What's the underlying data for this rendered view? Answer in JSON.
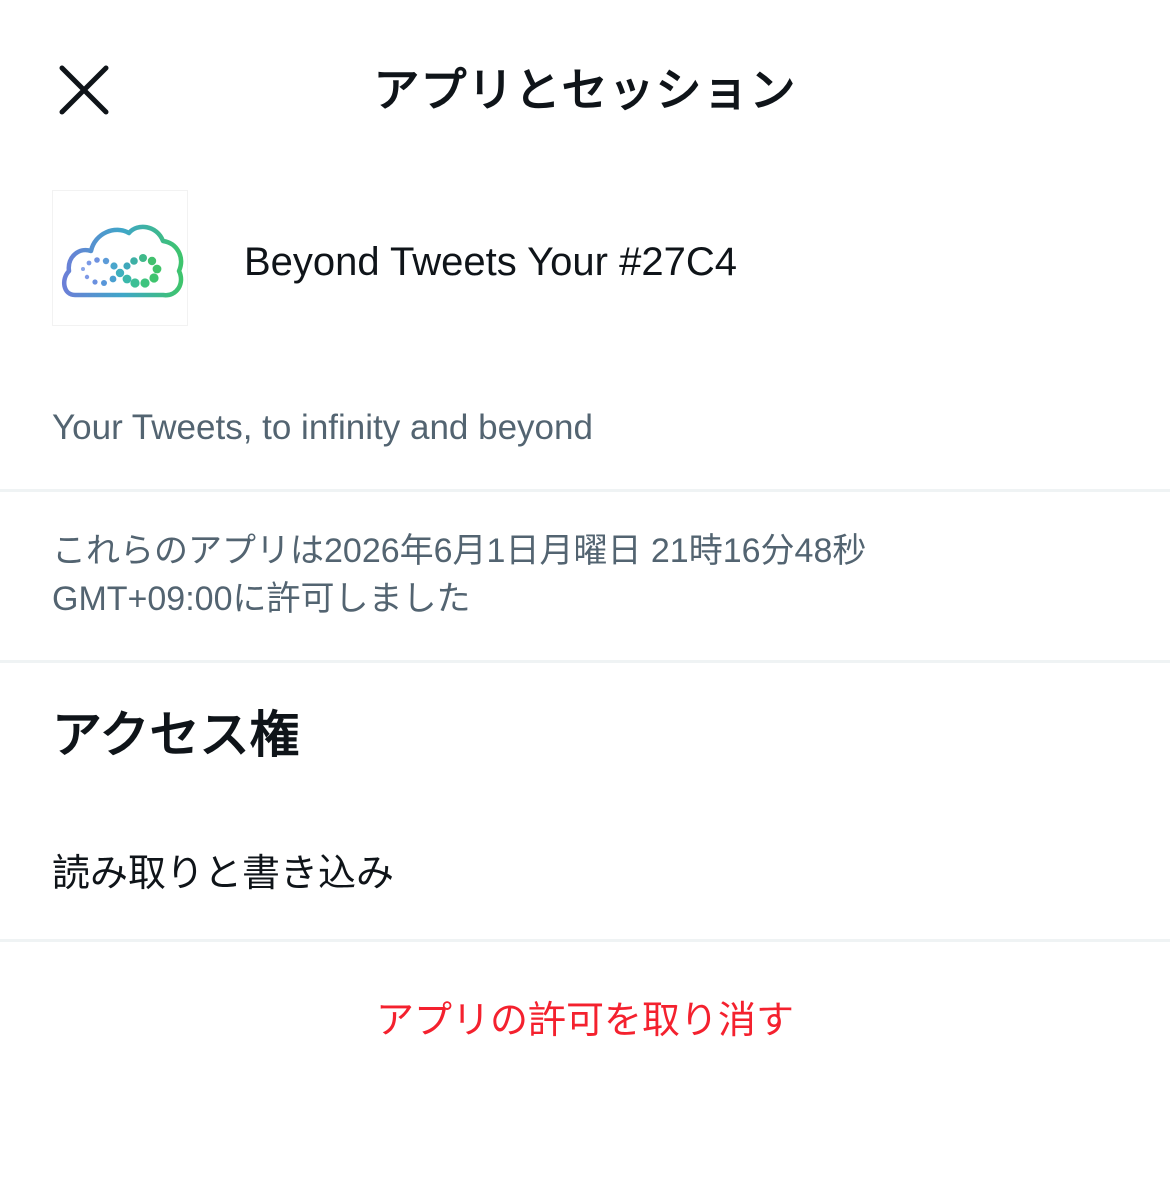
{
  "header": {
    "title": "アプリとセッション",
    "close_icon": "close-icon"
  },
  "app": {
    "name": "Beyond Tweets Your #27C4",
    "description": "Your Tweets, to infinity and beyond",
    "logo_icon": "cloud-infinity-logo"
  },
  "granted": {
    "line1": "これらのアプリは2026年6月1日月曜日 21時16分48秒",
    "line2": "GMT+09:00に許可しました"
  },
  "access": {
    "title": "アクセス権",
    "permission": "読み取りと書き込み"
  },
  "actions": {
    "revoke_label": "アプリの許可を取り消す"
  },
  "colors": {
    "text_primary": "#0f1419",
    "text_secondary": "#536471",
    "danger": "#f4212e",
    "divider": "#eff3f4"
  }
}
